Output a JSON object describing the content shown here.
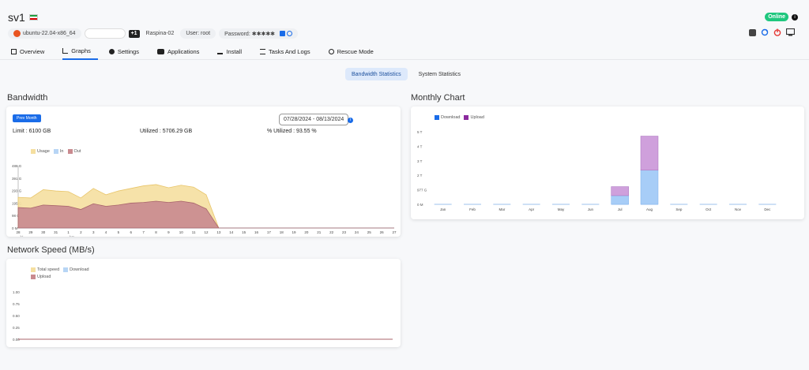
{
  "server": {
    "name": "sv1",
    "status": "Online",
    "status_info": "i"
  },
  "tags": {
    "os": "ubuntu-22.04-x86_64",
    "badge": "+1",
    "location": "Raspina-02",
    "user": "User: root",
    "password": "Password: ✱✱✱✱✱"
  },
  "tabs": [
    {
      "label": "Overview"
    },
    {
      "label": "Graphs"
    },
    {
      "label": "Settings"
    },
    {
      "label": "Applications"
    },
    {
      "label": "Install"
    },
    {
      "label": "Tasks And Logs"
    },
    {
      "label": "Rescue Mode"
    }
  ],
  "subtabs": {
    "bandwidth": "Bandwidth Statistics",
    "system": "System Statistics"
  },
  "bandwidth": {
    "title": "Bandwidth",
    "prev_button": "Prev Month",
    "limit": "Limit : 6100 GB",
    "utilized": "Utilized : 5706.29 GB",
    "percent": "% Utilized : 93.55 %",
    "date_range": "07/28/2024 - 08/13/2024",
    "date_info": "i"
  },
  "monthly": {
    "title": "Monthly Chart"
  },
  "network": {
    "title": "Network Speed (MB/s)"
  },
  "colors": {
    "accent": "#1a6ce8",
    "usage": "#f5dfa0",
    "in": "#b7d5f5",
    "out": "#c98a8f",
    "download": "#a7cdf7",
    "upload": "#cfa0dc",
    "online": "#1fc77e"
  },
  "chart_data": [
    {
      "type": "area",
      "legend": [
        "Usage",
        "In",
        "Out"
      ],
      "x": [
        "28",
        "29",
        "30",
        "31",
        "1",
        "2",
        "3",
        "4",
        "5",
        "6",
        "7",
        "8",
        "9",
        "10",
        "11",
        "12",
        "13",
        "14",
        "15",
        "16",
        "17",
        "18",
        "19",
        "20",
        "21",
        "22",
        "23",
        "24",
        "25",
        "26",
        "27"
      ],
      "x_sublabels": {
        "28": "Jul",
        "1": "Aug"
      },
      "y_ticks": [
        "0 M",
        "98 G",
        "195 G",
        "293 G",
        "391 G",
        "488 G"
      ],
      "ylim": [
        0,
        488
      ],
      "series": [
        {
          "name": "Usage",
          "values": [
            240,
            235,
            300,
            290,
            285,
            235,
            310,
            260,
            290,
            310,
            330,
            340,
            315,
            335,
            320,
            260,
            0,
            0,
            0,
            0,
            0,
            0,
            0,
            0,
            0,
            0,
            0,
            0,
            0,
            0,
            0
          ]
        },
        {
          "name": "In",
          "values": [
            0,
            0,
            0,
            0,
            0,
            0,
            0,
            0,
            0,
            0,
            0,
            0,
            0,
            0,
            0,
            0,
            0,
            0,
            0,
            0,
            0,
            0,
            0,
            0,
            0,
            0,
            0,
            0,
            0,
            0,
            0
          ]
        },
        {
          "name": "Out",
          "values": [
            160,
            155,
            180,
            175,
            170,
            145,
            190,
            170,
            180,
            195,
            200,
            210,
            200,
            210,
            195,
            150,
            0,
            0,
            0,
            0,
            0,
            0,
            0,
            0,
            0,
            0,
            0,
            0,
            0,
            0,
            0
          ]
        }
      ]
    },
    {
      "type": "bar",
      "legend": [
        "Download",
        "Upload"
      ],
      "categories": [
        "Jan",
        "Feb",
        "Mar",
        "Apr",
        "May",
        "Jun",
        "Jul",
        "Aug",
        "Sep",
        "Oct",
        "Nov",
        "Dec"
      ],
      "y_ticks": [
        "0 M",
        "977 G",
        "2 T",
        "3 T",
        "4 T",
        "5 T"
      ],
      "ylim": [
        0,
        5
      ],
      "series": [
        {
          "name": "Download",
          "values": [
            0,
            0,
            0,
            0,
            0,
            0,
            0.6,
            2.35,
            0,
            0,
            0,
            0
          ]
        },
        {
          "name": "Upload",
          "values": [
            0,
            0,
            0,
            0,
            0,
            0,
            0.62,
            2.35,
            0,
            0,
            0,
            0
          ]
        }
      ]
    },
    {
      "type": "line",
      "legend": [
        "Total speed",
        "Download",
        "Upload"
      ],
      "y_ticks": [
        "0.00",
        "0.25",
        "0.50",
        "0.75",
        "1.00"
      ],
      "ylim": [
        0,
        1
      ],
      "series": [
        {
          "name": "Total speed",
          "values": [
            0,
            0
          ]
        },
        {
          "name": "Download",
          "values": [
            0,
            0
          ]
        },
        {
          "name": "Upload",
          "values": [
            0,
            0
          ]
        }
      ]
    }
  ]
}
